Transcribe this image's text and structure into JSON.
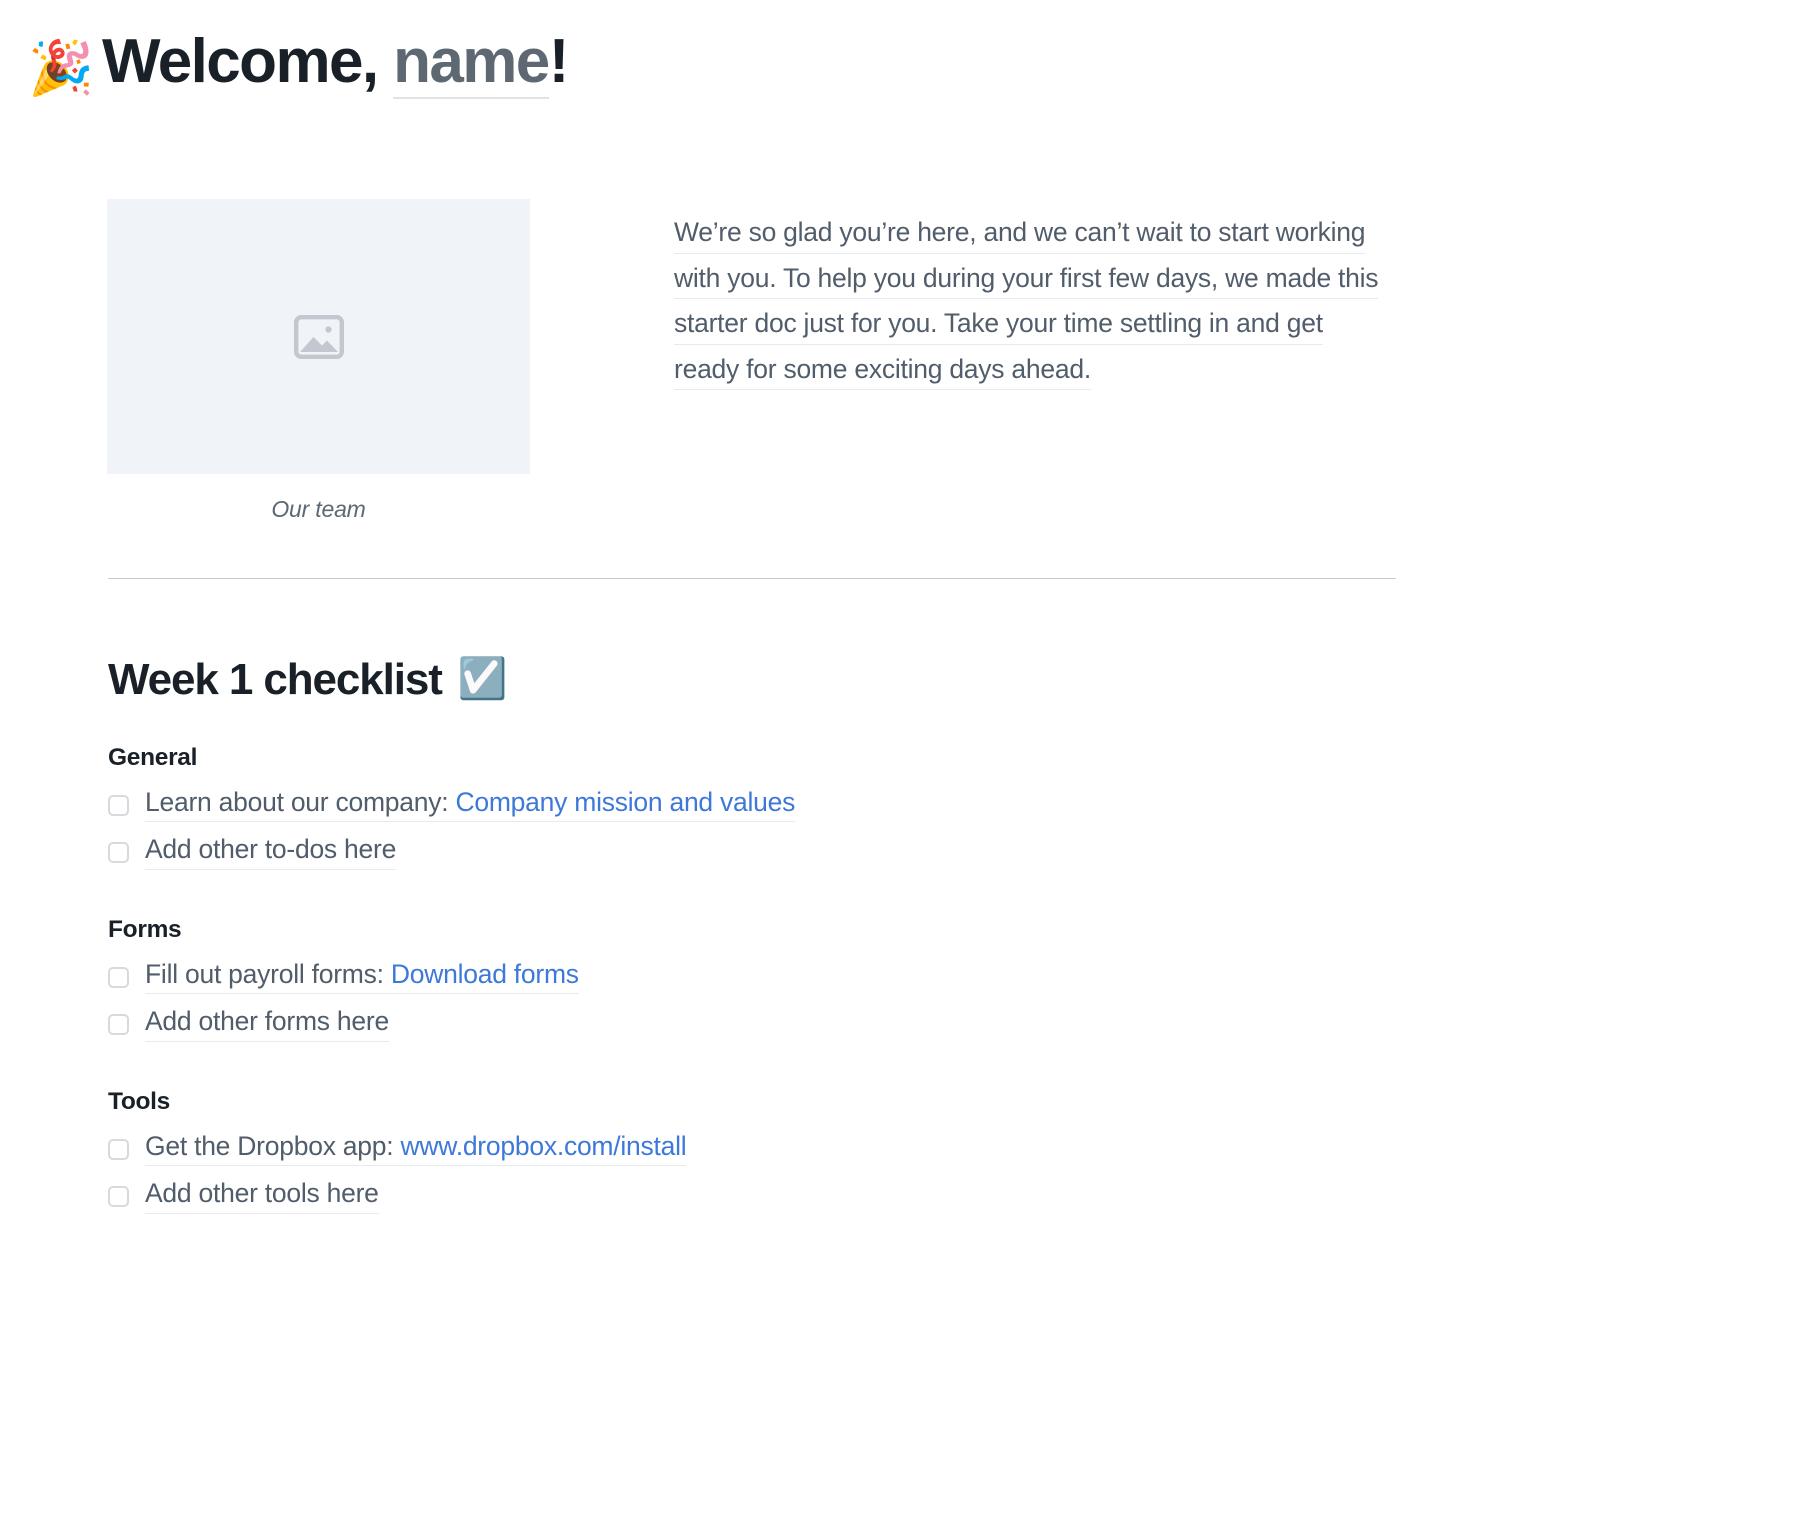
{
  "page": {
    "background": "#ffffff",
    "accent_link_color": "#3e78d8",
    "text_color": "#515d6b",
    "heading_color": "#1a2027"
  },
  "header": {
    "emoji": "🎉",
    "emoji_name": "party-popper-emoji",
    "welcome_text": "Welcome, ",
    "name_placeholder": "name",
    "exclamation": "!"
  },
  "intro": {
    "image_placeholder_name": "image-placeholder",
    "image_caption": "Our team",
    "paragraph_lines": [
      "We’re so glad you’re here, and we can’t wait to start working",
      "with you. To help you during your first few days, we made this",
      "starter doc just for you. Take your time settling in and get",
      "ready for some exciting days ahead."
    ]
  },
  "checklist": {
    "title": "Week 1 checklist",
    "title_emoji": "☑️",
    "title_emoji_name": "ballot-box-with-check-emoji",
    "groups": [
      {
        "heading": "General",
        "items": [
          {
            "prefix": "Learn about our company: ",
            "link": "Company mission and values"
          },
          {
            "prefix": "Add other to-dos here",
            "link": ""
          }
        ]
      },
      {
        "heading": "Forms",
        "items": [
          {
            "prefix": "Fill out payroll forms: ",
            "link": "Download forms"
          },
          {
            "prefix": "Add other forms here",
            "link": ""
          }
        ]
      },
      {
        "heading": "Tools",
        "items": [
          {
            "prefix": "Get the Dropbox app: ",
            "link": "www.dropbox.com/install"
          },
          {
            "prefix": "Add other tools here",
            "link": ""
          }
        ]
      }
    ]
  }
}
